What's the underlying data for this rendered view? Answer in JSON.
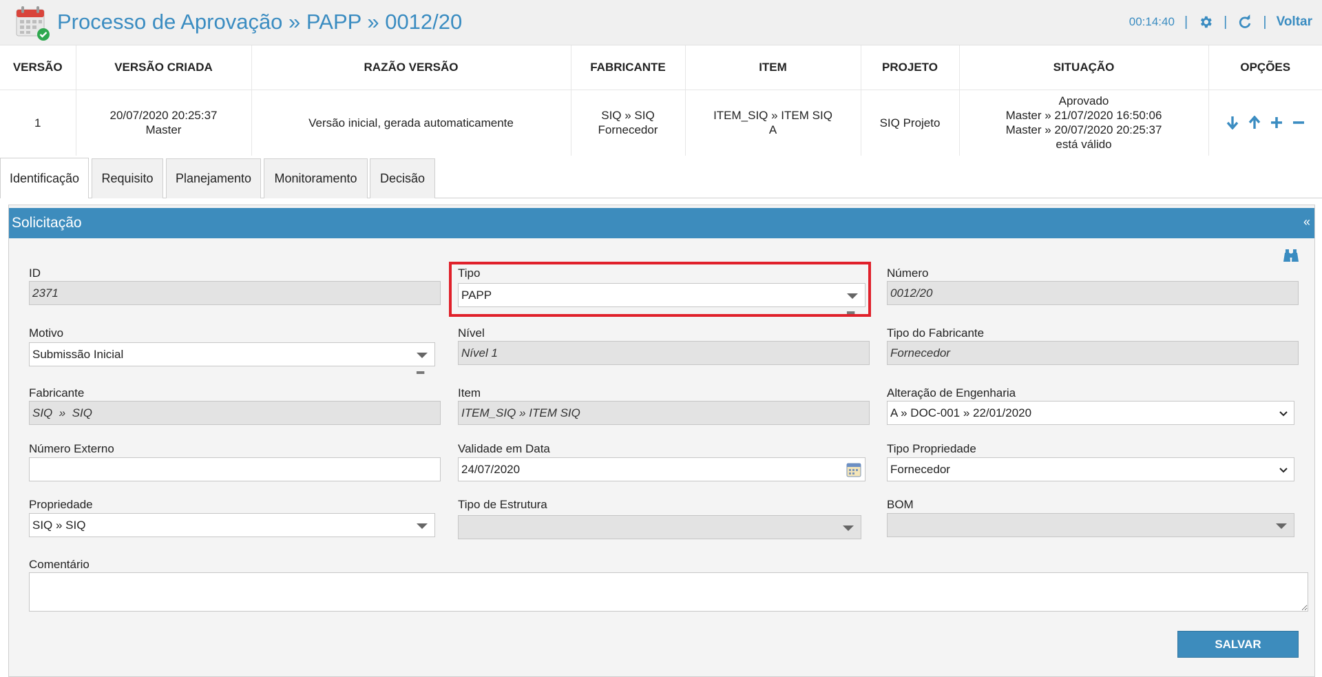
{
  "header": {
    "title": "Processo de Aprovação » PAPP » 0012/20",
    "timer": "00:14:40",
    "back_label": "Voltar"
  },
  "versions_table": {
    "columns": [
      "VERSÃO",
      "VERSÃO CRIADA",
      "RAZÃO VERSÃO",
      "FABRICANTE",
      "ITEM",
      "PROJETO",
      "SITUAÇÃO",
      "OPÇÕES"
    ],
    "row": {
      "versao": "1",
      "criada_line1": "20/07/2020 20:25:37",
      "criada_line2": "Master",
      "razao": "Versão inicial, gerada automaticamente",
      "fabricante_line1": "SIQ » SIQ",
      "fabricante_line2": "Fornecedor",
      "item_line1": "ITEM_SIQ » ITEM SIQ",
      "item_line2": "A",
      "projeto": "SIQ Projeto",
      "situacao_line1": "Aprovado",
      "situacao_line2": "Master » 21/07/2020 16:50:06",
      "situacao_line3": "Master » 20/07/2020 20:25:37",
      "situacao_line4": "está válido"
    },
    "option_icons": [
      "arrow-down-icon",
      "arrow-up-icon",
      "plus-icon",
      "minus-icon"
    ]
  },
  "tabs": [
    {
      "label": "Identificação",
      "active": true
    },
    {
      "label": "Requisito",
      "active": false
    },
    {
      "label": "Planejamento",
      "active": false
    },
    {
      "label": "Monitoramento",
      "active": false
    },
    {
      "label": "Decisão",
      "active": false
    }
  ],
  "panel": {
    "title": "Solicitação",
    "collapse_label": "«"
  },
  "form": {
    "id": {
      "label": "ID",
      "value": "2371"
    },
    "tipo": {
      "label": "Tipo",
      "value": "PAPP"
    },
    "numero": {
      "label": "Número",
      "value": "0012/20"
    },
    "motivo": {
      "label": "Motivo",
      "value": "Submissão Inicial"
    },
    "nivel": {
      "label": "Nível",
      "value": "Nível 1"
    },
    "tipo_fabricante": {
      "label": "Tipo do Fabricante",
      "value": "Fornecedor"
    },
    "fabricante": {
      "label": "Fabricante",
      "value": "SIQ  »  SIQ"
    },
    "item": {
      "label": "Item",
      "value": "ITEM_SIQ » ITEM SIQ"
    },
    "alteracao": {
      "label": "Alteração de Engenharia",
      "value": "A » DOC-001 » 22/01/2020"
    },
    "numero_externo": {
      "label": "Número Externo",
      "value": ""
    },
    "validade": {
      "label": "Validade em Data",
      "value": "24/07/2020"
    },
    "tipo_propriedade": {
      "label": "Tipo Propriedade",
      "value": "Fornecedor"
    },
    "propriedade": {
      "label": "Propriedade",
      "value": "SIQ » SIQ"
    },
    "tipo_estrutura": {
      "label": "Tipo de Estrutura",
      "value": ""
    },
    "bom": {
      "label": "BOM",
      "value": ""
    },
    "comentario": {
      "label": "Comentário",
      "value": ""
    },
    "save_label": "SALVAR"
  },
  "colors": {
    "accent": "#3d8cbd",
    "title_blue": "#3a8cc1",
    "highlight_red": "#e0202a"
  }
}
